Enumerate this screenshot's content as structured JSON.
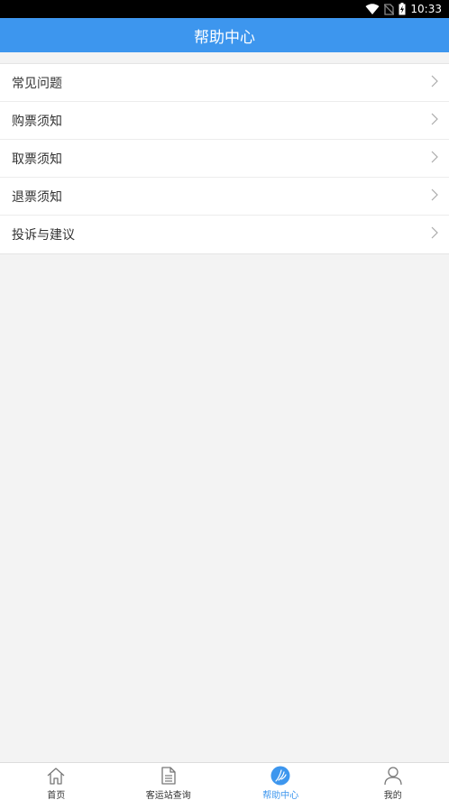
{
  "status_bar": {
    "time": "10:33",
    "icons": [
      "wifi-icon",
      "no-sim-icon",
      "battery-charging-icon"
    ]
  },
  "header": {
    "title": "帮助中心"
  },
  "menu": {
    "items": [
      {
        "label": "常见问题",
        "icon": "chevron-right-icon"
      },
      {
        "label": "购票须知",
        "icon": "chevron-right-icon"
      },
      {
        "label": "取票须知",
        "icon": "chevron-right-icon"
      },
      {
        "label": "退票须知",
        "icon": "chevron-right-icon"
      },
      {
        "label": "投诉与建议",
        "icon": "chevron-right-icon"
      }
    ]
  },
  "tab_bar": {
    "tabs": [
      {
        "label": "首页",
        "icon": "home-icon",
        "active": false
      },
      {
        "label": "客运站查询",
        "icon": "document-icon",
        "active": false
      },
      {
        "label": "帮助中心",
        "icon": "help-icon",
        "active": true
      },
      {
        "label": "我的",
        "icon": "user-icon",
        "active": false
      }
    ]
  },
  "colors": {
    "accent": "#3d96ee",
    "background": "#f3f3f3",
    "status_bar": "#000000"
  }
}
